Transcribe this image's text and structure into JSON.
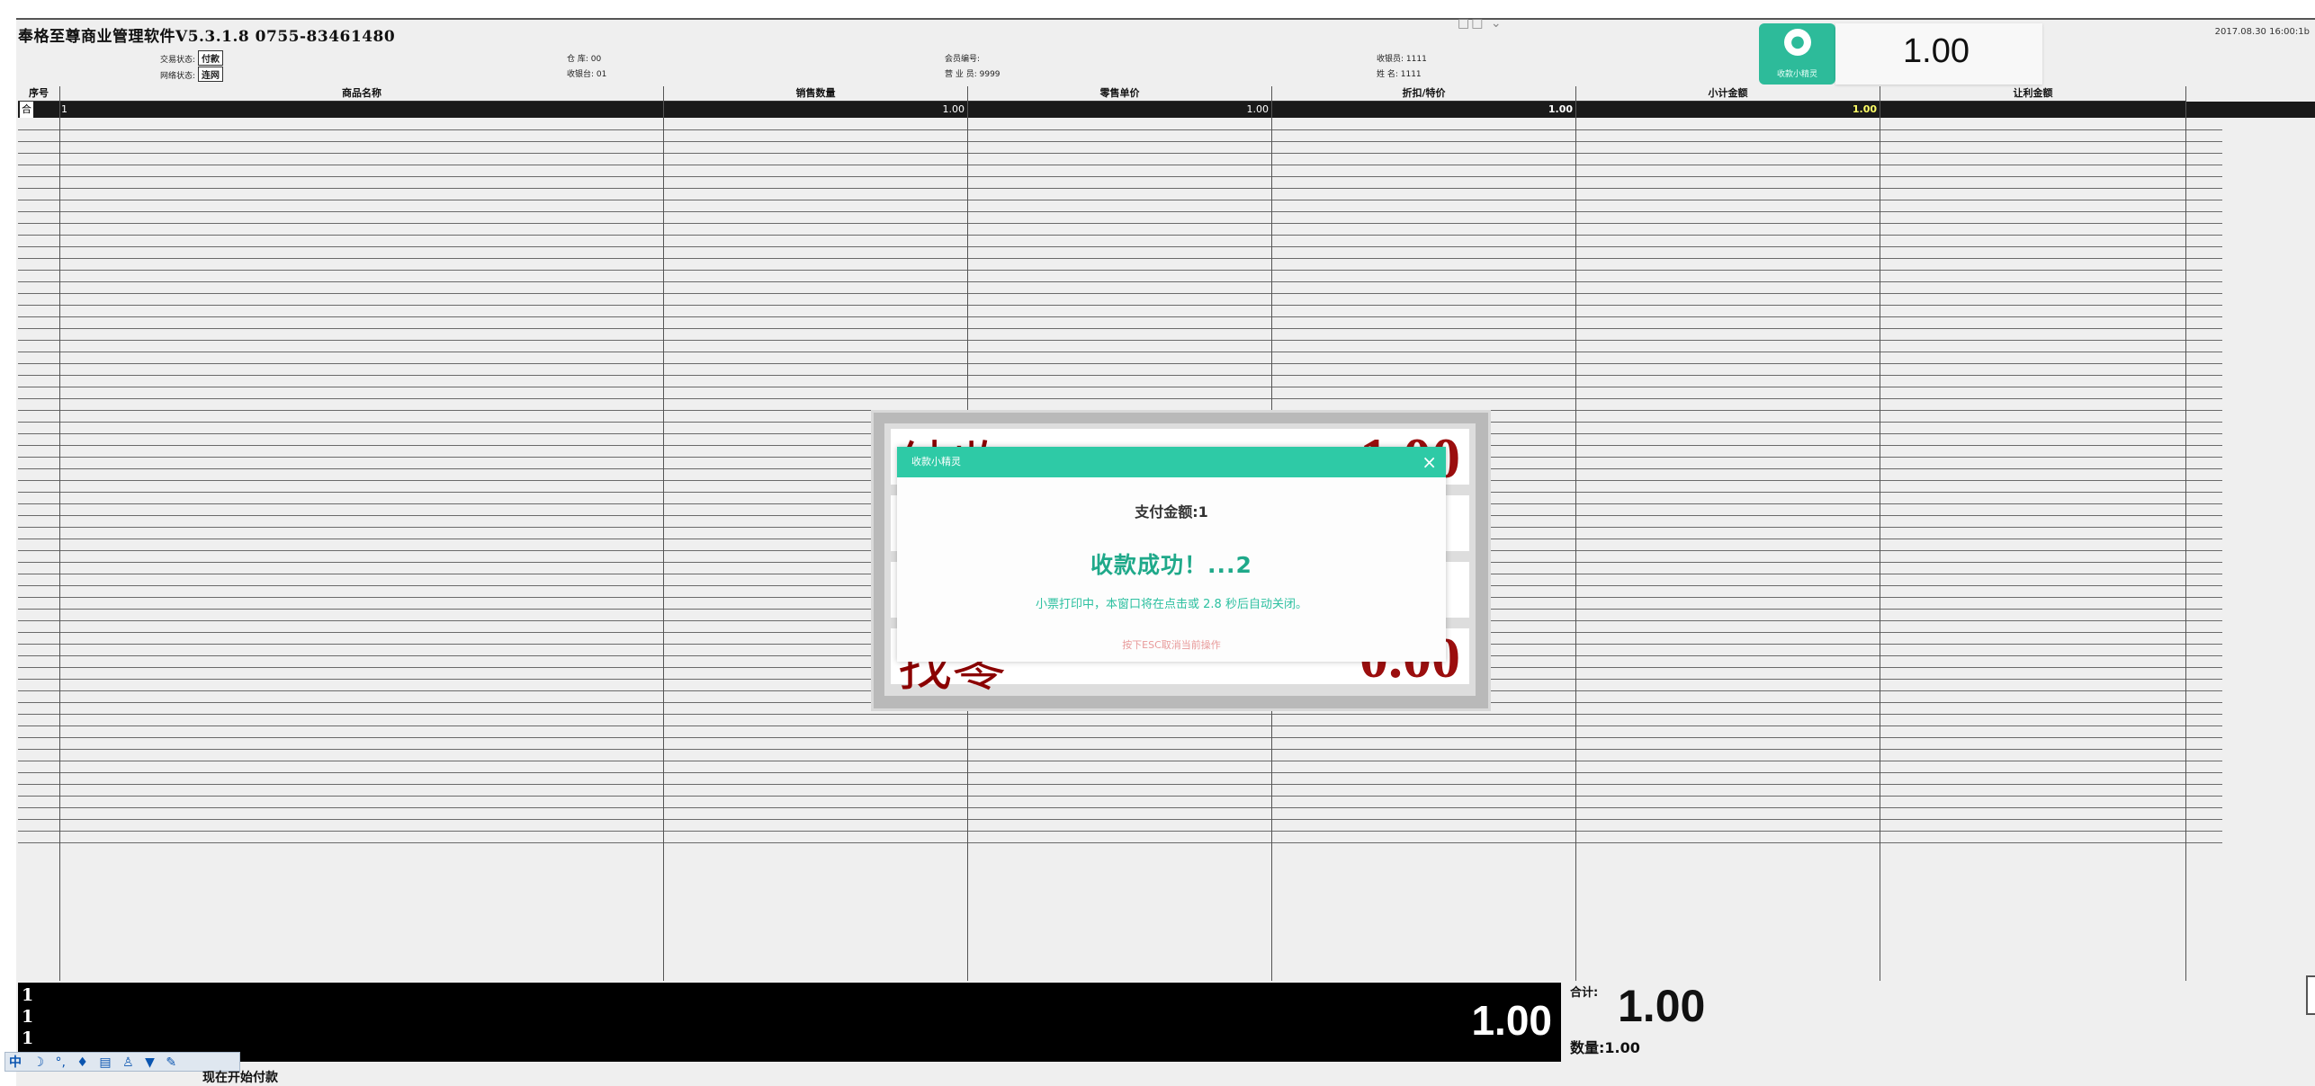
{
  "app": {
    "title": "奉格至尊商业管理软件V5.3.1.8 0755-83461480",
    "datetime": "2017.08.30 16:00:1b",
    "window_handle": "□□ ⌄"
  },
  "info": {
    "trade_status_label": "交易状态:",
    "trade_status_value": "付款",
    "network_status_label": "网络状态:",
    "network_status_value": "连网",
    "warehouse": "仓 库: 00",
    "register": "收银台: 01",
    "member_no": "会员编号:",
    "salesperson": "营 业 员: 9999",
    "cashier": "收银员: 1111",
    "name": "姓 名: 1111"
  },
  "cashier_widget": {
    "icon": "cashier-helper-icon",
    "label": "收款小精灵",
    "amount": "1.00"
  },
  "table": {
    "headers": [
      "序号",
      "商品名称",
      "销售数量",
      "零售单价",
      "折扣/特价",
      "小计金额",
      "让利金额"
    ],
    "row": {
      "marker": "合",
      "index": "1",
      "qty": "1.00",
      "price": "1.00",
      "discount_price": "1.00",
      "subtotal": "1.00"
    }
  },
  "bottom": {
    "lines": [
      "1",
      "1",
      "1"
    ],
    "amount": "1.00",
    "total_label": "合计:",
    "total_value": "1.00",
    "qty_label": "数量:",
    "qty_value": "1.00",
    "status_message": "现在开始付款"
  },
  "taskbar": {
    "ime": "中",
    "icons": [
      "moon-icon",
      "punct-icon",
      "mic-icon",
      "keyboard-icon",
      "user-icon",
      "shirt-icon",
      "wrench-icon"
    ]
  },
  "payment_panel": {
    "settle_label": "结收",
    "settle_value": "1.00",
    "change_label": "找零",
    "change_value": "0.00"
  },
  "dialog": {
    "title": "收款小精灵",
    "close_label": "×",
    "pay_amount": "支付金额:1",
    "success": "收款成功！...2",
    "message": "小票打印中，本窗口将在点击或 2.8 秒后自动关闭。",
    "esc_hint": "按下ESC取消当前操作"
  },
  "colors": {
    "accent": "#2ecaa6",
    "amount_red": "#9b0e0e",
    "selected_row": "#1a1a1a"
  }
}
